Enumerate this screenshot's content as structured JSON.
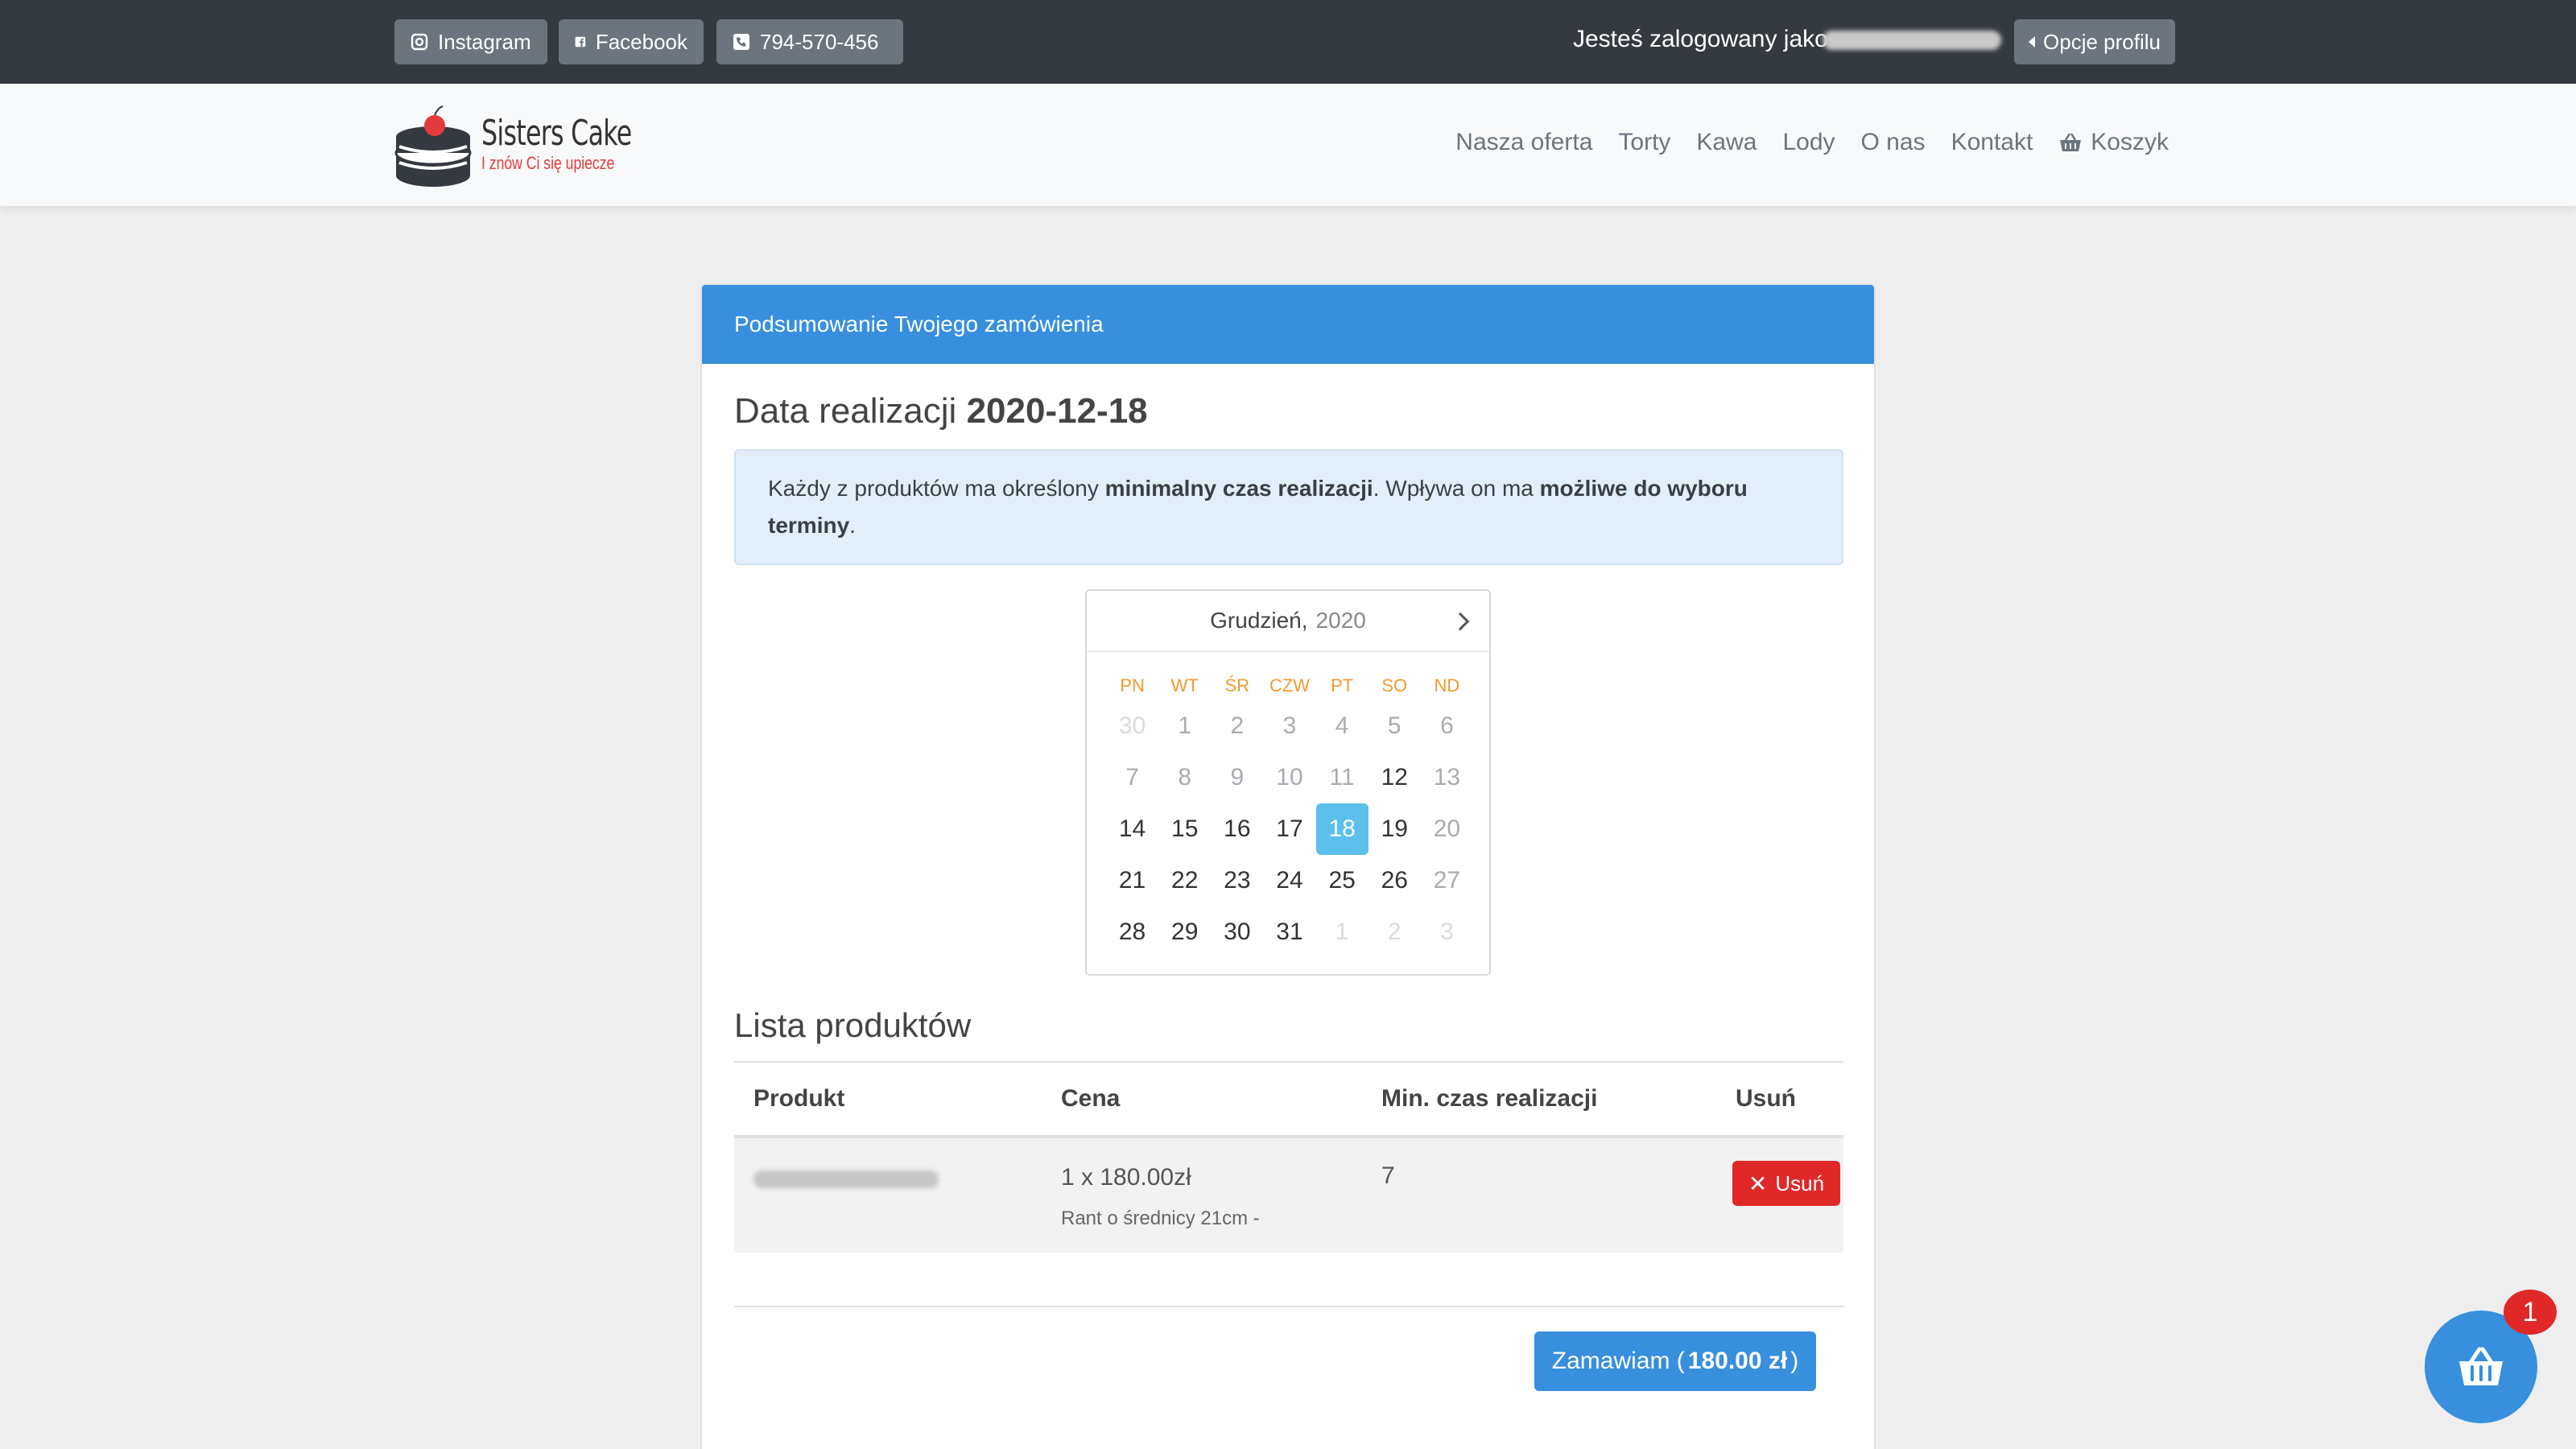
{
  "topbar": {
    "social": [
      {
        "label": "Instagram",
        "icon": "instagram-icon"
      },
      {
        "label": "Facebook",
        "icon": "facebook-icon"
      },
      {
        "label": "794-570-456",
        "icon": "phone-icon"
      }
    ],
    "logged_in_label": "Jesteś zalogowany jako",
    "profile_button": "Opcje profilu"
  },
  "brand": {
    "name": "Sisters Cake",
    "tagline": "I znów Ci się upiecze"
  },
  "nav": {
    "items": [
      "Nasza oferta",
      "Torty",
      "Kawa",
      "Lody",
      "O nas",
      "Kontakt"
    ],
    "cart_label": "Koszyk"
  },
  "summary": {
    "header": "Podsumowanie Twojego zamówienia",
    "date_label": "Data realizacji",
    "date_value": "2020-12-18",
    "info_parts": [
      "Każdy z produktów ma określony",
      "minimalny czas realizacji",
      ". Wpływa on ma",
      "możliwe do wyboru terminy",
      "."
    ]
  },
  "calendar": {
    "month": "Grudzień,",
    "year": "2020",
    "weekdays": [
      "PN",
      "WT",
      "ŚR",
      "CZW",
      "PT",
      "SO",
      "ND"
    ],
    "weeks": [
      [
        "30",
        "1",
        "2",
        "3",
        "4",
        "5",
        "6"
      ],
      [
        "7",
        "8",
        "9",
        "10",
        "11",
        "12",
        "13"
      ],
      [
        "14",
        "15",
        "16",
        "17",
        "18",
        "19",
        "20"
      ],
      [
        "21",
        "22",
        "23",
        "24",
        "25",
        "26",
        "27"
      ],
      [
        "28",
        "29",
        "30",
        "31",
        "1",
        "2",
        "3"
      ]
    ],
    "selected": "18"
  },
  "products": {
    "title": "Lista produktów",
    "columns": [
      "Produkt",
      "Cena",
      "Min. czas realizacji",
      "Usuń"
    ],
    "rows": [
      {
        "price": "1 x 180.00zł",
        "note": "Rant o średnicy 21cm -",
        "min_time": "7",
        "remove": "Usuń"
      }
    ]
  },
  "order": {
    "label": "Zamawiam (",
    "amount": "180.00 zł",
    "close": ")"
  },
  "cart_fab": {
    "count": "1"
  },
  "colors": {
    "primary": "#378fdd",
    "danger": "#e02828",
    "topbar": "#343a40",
    "calendar_selected": "#5bc0eb",
    "weekday": "#f09a2e"
  }
}
